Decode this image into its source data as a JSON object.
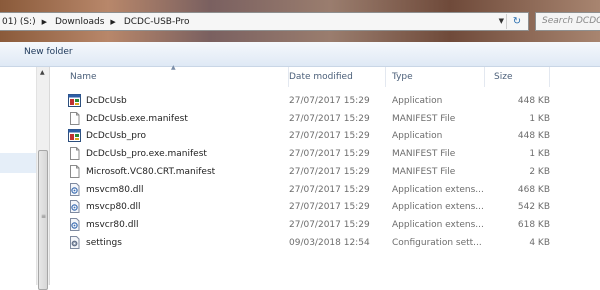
{
  "address": {
    "drive": "01) (S:)",
    "crumbs": [
      "Downloads",
      "DCDC-USB-Pro"
    ]
  },
  "search": {
    "placeholder": "Search DCDC-USB-Pro"
  },
  "toolbar": {
    "new_folder": "New folder"
  },
  "columns": {
    "name": "Name",
    "date": "Date modified",
    "type": "Type",
    "size": "Size"
  },
  "files": [
    {
      "name": "DcDcUsb",
      "date": "27/07/2017 15:29",
      "type": "Application",
      "size": "448 KB",
      "icon": "application-icon"
    },
    {
      "name": "DcDcUsb.exe.manifest",
      "date": "27/07/2017 15:29",
      "type": "MANIFEST File",
      "size": "1 KB",
      "icon": "document-icon"
    },
    {
      "name": "DcDcUsb_pro",
      "date": "27/07/2017 15:29",
      "type": "Application",
      "size": "448 KB",
      "icon": "application-icon"
    },
    {
      "name": "DcDcUsb_pro.exe.manifest",
      "date": "27/07/2017 15:29",
      "type": "MANIFEST File",
      "size": "1 KB",
      "icon": "document-icon"
    },
    {
      "name": "Microsoft.VC80.CRT.manifest",
      "date": "27/07/2017 15:29",
      "type": "MANIFEST File",
      "size": "2 KB",
      "icon": "document-icon"
    },
    {
      "name": "msvcm80.dll",
      "date": "27/07/2017 15:29",
      "type": "Application extens...",
      "size": "468 KB",
      "icon": "dll-icon"
    },
    {
      "name": "msvcp80.dll",
      "date": "27/07/2017 15:29",
      "type": "Application extens...",
      "size": "542 KB",
      "icon": "dll-icon"
    },
    {
      "name": "msvcr80.dll",
      "date": "27/07/2017 15:29",
      "type": "Application extens...",
      "size": "618 KB",
      "icon": "dll-icon"
    },
    {
      "name": "settings",
      "date": "09/03/2018 12:54",
      "type": "Configuration sett...",
      "size": "4 KB",
      "icon": "settings-file-icon"
    }
  ]
}
